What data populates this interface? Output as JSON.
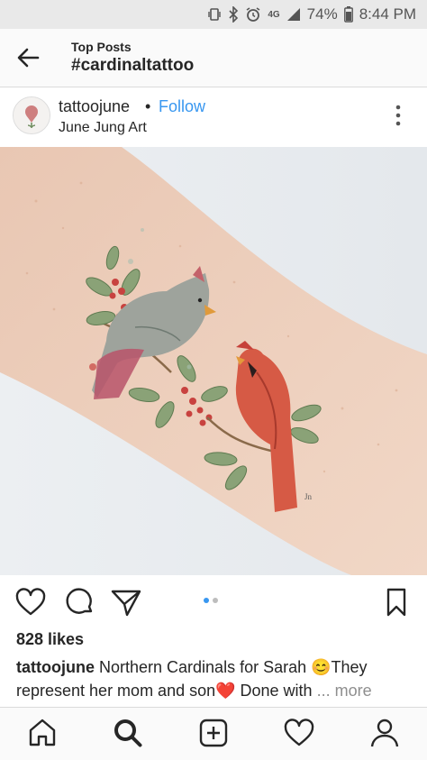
{
  "status_bar": {
    "battery": "74%",
    "time": "8:44 PM",
    "network": "4G",
    "icons": [
      "vibrate-icon",
      "bluetooth-icon",
      "alarm-icon",
      "network-4g-icon",
      "signal-icon",
      "battery-icon"
    ]
  },
  "header": {
    "subtitle": "Top Posts",
    "title": "#cardinaltattoo"
  },
  "post": {
    "username": "tattoojune",
    "separator": "•",
    "follow_label": "Follow",
    "location": "June Jung Art",
    "image_description": "",
    "carousel": {
      "count": 2,
      "active": 0
    },
    "likes": "828 likes",
    "caption_user": "tattoojune",
    "caption_text": " Northern Cardinals for Sarah 😊They represent her mom and son❤️ Done with ",
    "caption_more": "... more"
  },
  "nav": {
    "items": [
      "home-icon",
      "search-icon",
      "add-post-icon",
      "activity-heart-icon",
      "profile-icon"
    ]
  },
  "colors": {
    "accent": "#3897f0",
    "text": "#262626",
    "muted": "#8e8e8e",
    "header_bg": "#fafafa",
    "status_bg": "#e9e9e9"
  }
}
